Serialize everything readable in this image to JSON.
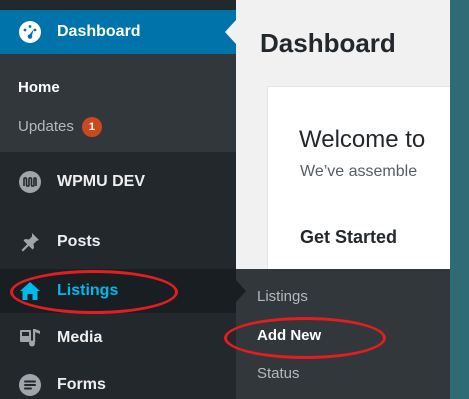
{
  "sidebar": {
    "dashboard": {
      "label": "Dashboard",
      "icon": "gauge-icon"
    },
    "dashboard_submenu": {
      "home": "Home",
      "updates": "Updates",
      "updates_count": "1"
    },
    "wpmudev": {
      "label": "WPMU DEV",
      "icon": "wpmudev-logo-icon"
    },
    "posts": {
      "label": "Posts",
      "icon": "pushpin-icon"
    },
    "listings": {
      "label": "Listings",
      "icon": "house-icon"
    },
    "media": {
      "label": "Media",
      "icon": "media-icon"
    },
    "forms": {
      "label": "Forms",
      "icon": "forms-icon"
    }
  },
  "listings_flyout": {
    "items": [
      "Listings",
      "Add New",
      "Status"
    ]
  },
  "main": {
    "page_title": "Dashboard",
    "welcome": {
      "title": "Welcome to",
      "subtitle": "We’ve assemble",
      "get_started": "Get Started"
    }
  },
  "colors": {
    "menu_background": "#23282d",
    "submenu_background": "#32373c",
    "active_blue": "#0073aa",
    "listings_text": "#00b9eb",
    "update_badge": "#ca4a1f",
    "annotation_red": "#e41d20",
    "outer_background": "#2e6b74"
  }
}
